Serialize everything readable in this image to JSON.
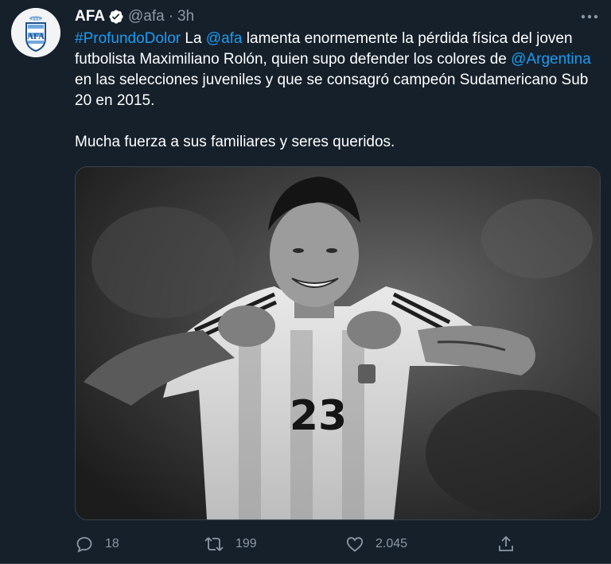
{
  "tweet": {
    "author": {
      "display_name": "AFA",
      "handle": "@afa",
      "separator": "·",
      "time": "3h",
      "verified": true
    },
    "text": {
      "hashtag": "#ProfundoDolor",
      "part1": " La ",
      "mention1": "@afa",
      "part2": " lamenta enormemente la pérdida física del joven futbolista Maximiliano Rolón, quien supo defender los colores de ",
      "mention2": "@Argentina",
      "part3": " en las selecciones juveniles y que se consagró campeón Sudamericano Sub 20 en 2015.",
      "paragraph2": "Mucha fuerza a sus familiares y seres queridos."
    },
    "media": {
      "jersey_number": "23"
    },
    "stats": {
      "replies": "18",
      "retweets": "199",
      "likes": "2.045"
    }
  },
  "icons": {
    "verified": "verified-badge-icon",
    "more": "more-options-icon",
    "reply": "reply-icon",
    "retweet": "retweet-icon",
    "like": "heart-icon",
    "share": "share-icon"
  },
  "colors": {
    "background": "#15202b",
    "text": "#ffffff",
    "secondary_text": "#8b98a5",
    "link": "#1d9bf0",
    "border": "#38444d"
  }
}
